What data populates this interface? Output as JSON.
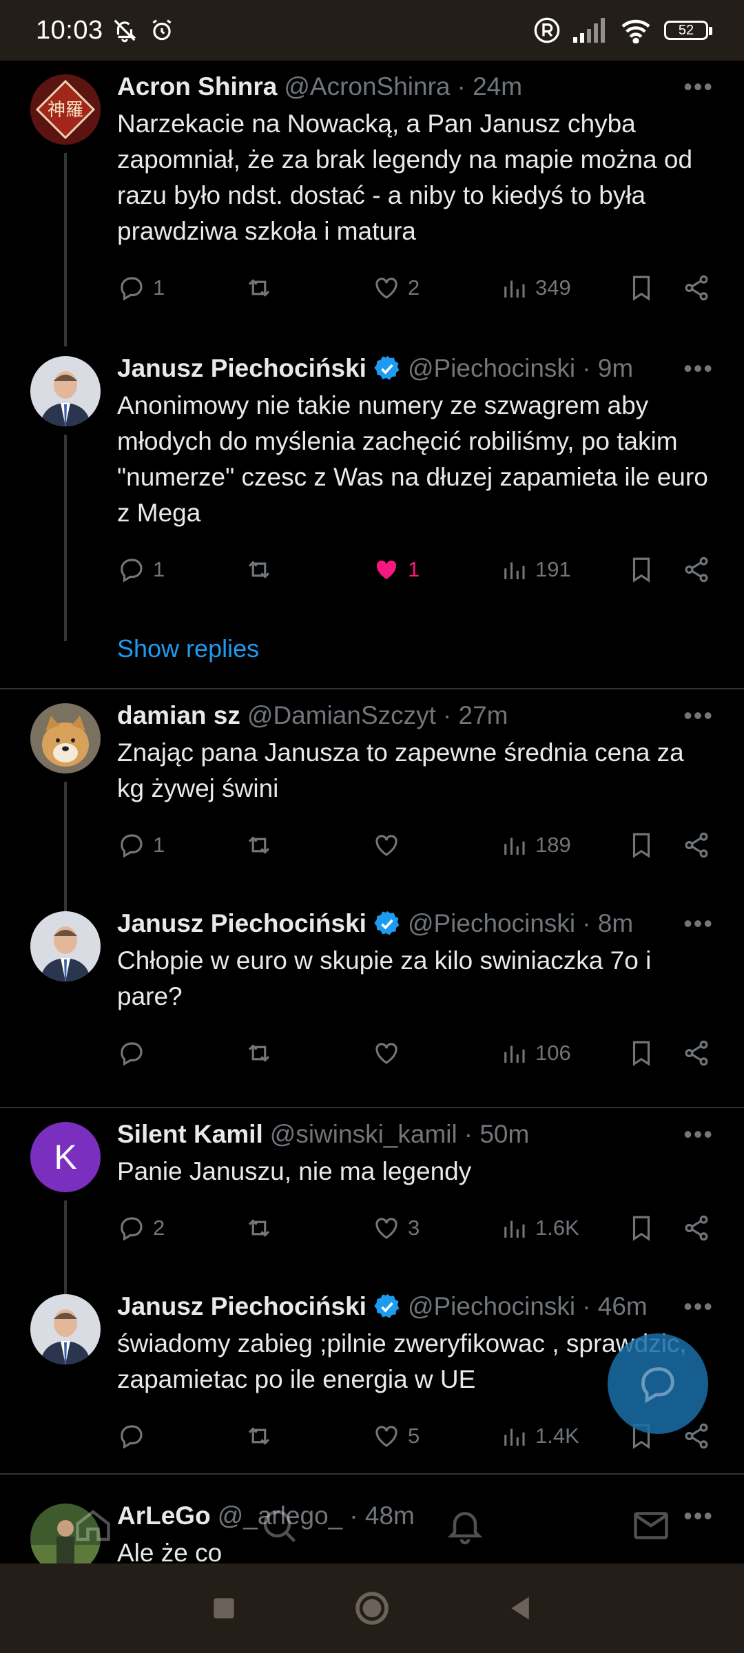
{
  "status": {
    "time": "10:03",
    "battery": "52"
  },
  "tweets": [
    {
      "name": "Acron Shinra",
      "handle": "@AcronShinra",
      "time": "· 24m",
      "verified": false,
      "text": "Narzekacie na Nowacką, a Pan Janusz chyba zapomniał, że za brak legendy na mapie można od razu było ndst. dostać - a niby to kiedyś to była prawdziwa szkoła i matura",
      "replies": "1",
      "retweets": "",
      "likes": "2",
      "views": "349",
      "liked": false
    },
    {
      "name": "Janusz Piechociński",
      "handle": "@Piechocinski",
      "time": "· 9m",
      "verified": true,
      "text": "Anonimowy  nie takie numery ze szwagrem aby młodych do myślenia zachęcić robiliśmy, po takim \"numerze\" czesc z Was na dłuzej zapamieta ile euro z Mega",
      "replies": "1",
      "retweets": "",
      "likes": "1",
      "views": "191",
      "liked": true
    },
    {
      "name": "damian sz",
      "handle": "@DamianSzczyt",
      "time": "· 27m",
      "verified": false,
      "text": "Znając pana Janusza to zapewne średnia cena za kg żywej świni",
      "replies": "1",
      "retweets": "",
      "likes": "",
      "views": "189",
      "liked": false
    },
    {
      "name": "Janusz Piechociński",
      "handle": "@Piechocinski",
      "time": "· 8m",
      "verified": true,
      "text": "Chłopie w euro w skupie za kilo swiniaczka 7o i pare?",
      "replies": "",
      "retweets": "",
      "likes": "",
      "views": "106",
      "liked": false
    },
    {
      "name": "Silent Kamil",
      "handle": "@siwinski_kamil",
      "time": "· 50m",
      "verified": false,
      "avatar_letter": "K",
      "text": "Panie Januszu, nie ma legendy",
      "replies": "2",
      "retweets": "",
      "likes": "3",
      "views": "1.6K",
      "liked": false
    },
    {
      "name": "Janusz Piechociński",
      "handle": "@Piechocinski",
      "time": "· 46m",
      "verified": true,
      "text": "świadomy zabieg ;pilnie zweryfikowac , sprawdzic, zapamietac po ile energia w UE",
      "replies": "",
      "retweets": "",
      "likes": "5",
      "views": "1.4K",
      "liked": false
    },
    {
      "name": "ArLeGo",
      "handle": "@_arlego_",
      "time": "· 48m",
      "verified": false,
      "text": "Ale że co"
    }
  ],
  "show_replies": "Show replies",
  "colors": {
    "accent": "#1d9bf0",
    "like": "#f91880",
    "muted": "#71767b"
  }
}
